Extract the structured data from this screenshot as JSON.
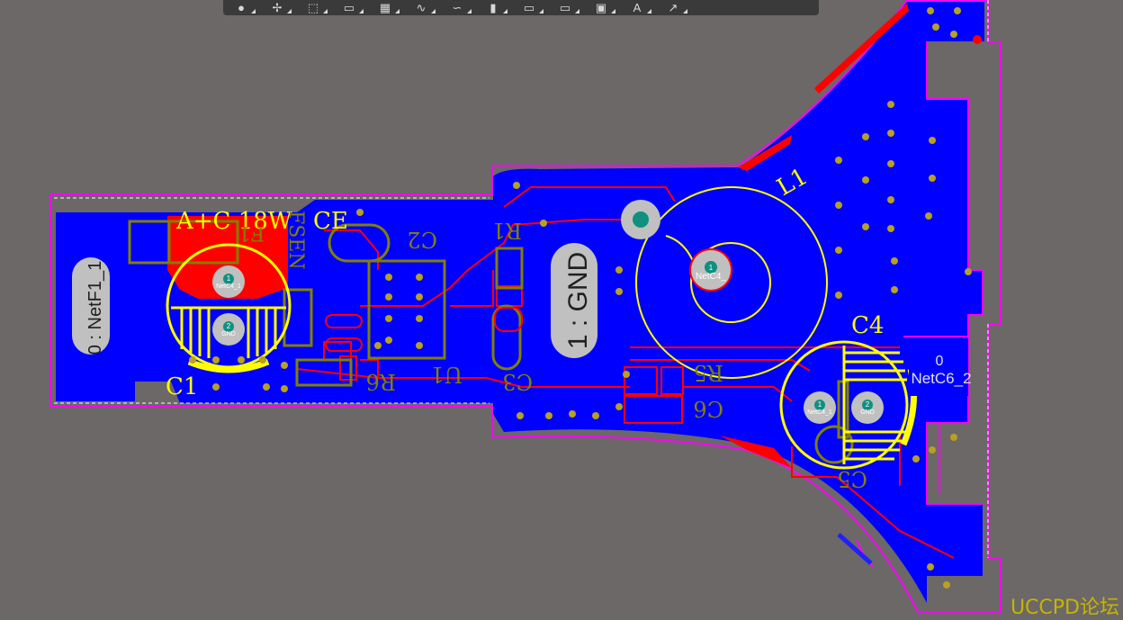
{
  "toolbar": {
    "tools": [
      {
        "name": "select-tool-icon",
        "glyph": "●"
      },
      {
        "name": "move-tool-icon",
        "glyph": "✢"
      },
      {
        "name": "area-select-tool-icon",
        "glyph": "⬚"
      },
      {
        "name": "line-tool-icon",
        "glyph": "▭"
      },
      {
        "name": "component-tool-icon",
        "glyph": "▦"
      },
      {
        "name": "route-tool-icon",
        "glyph": "∿"
      },
      {
        "name": "via-tool-icon",
        "glyph": "∽"
      },
      {
        "name": "pad-tool-icon",
        "glyph": "▮"
      },
      {
        "name": "fill-tool-icon",
        "glyph": "▭"
      },
      {
        "name": "polygon-tool-icon",
        "glyph": "▭"
      },
      {
        "name": "dimension-tool-icon",
        "glyph": "▣"
      },
      {
        "name": "text-tool-icon",
        "glyph": "A"
      },
      {
        "name": "arc-tool-icon",
        "glyph": "↗"
      }
    ]
  },
  "board": {
    "silkscreen": {
      "title": "A+C 18W",
      "ce": "CE",
      "c1": "C1",
      "c2": "C2",
      "c3": "C3",
      "c4": "C4",
      "c5": "C5",
      "c6": "C6",
      "r1": "R1",
      "r5": "R5",
      "r6": "R6",
      "u1": "U1",
      "l1": "L1",
      "f1": "F1",
      "fsen": "FSEN"
    },
    "pads": {
      "netf1": "0 : NetF1_1",
      "gnd_big": "1 : GND",
      "netc6_zero": "0",
      "netc6": "NetC6_2",
      "c1_pin1_num": "1",
      "c1_pin1_net": "NetC4_1",
      "c1_pin2_num": "2",
      "c1_pin2_net": "GND",
      "l1_pin_num": "1",
      "l1_pin_net": "NetC4_",
      "c4_pin1_num": "1",
      "c4_pin1_net": "NetC4_1",
      "c4_pin2_num": "2",
      "c4_pin2_net": "GND"
    },
    "colors": {
      "background": "#6b6867",
      "bottom_copper": "#0000ff",
      "top_copper": "#ff0000",
      "silkscreen": "#ffff00",
      "outline": "#ff00ff",
      "bottom_silk": "#808000",
      "via": "#b8a020"
    }
  },
  "watermark": "UCCPD论坛"
}
